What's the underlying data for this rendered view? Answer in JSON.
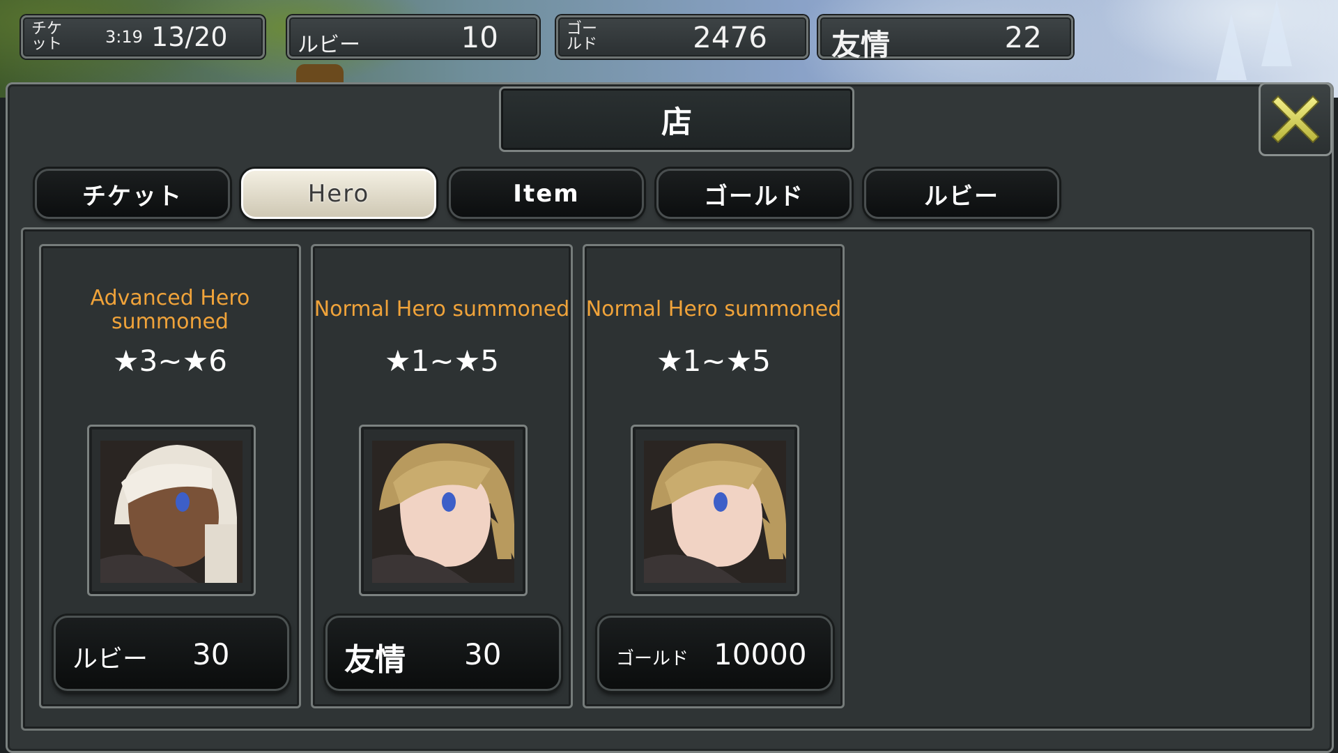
{
  "currency_bar": {
    "ticket": {
      "label": "チケット",
      "timer": "3:19",
      "value": "13/20"
    },
    "ruby": {
      "label": "ルビー",
      "value": "10"
    },
    "gold": {
      "label": "ゴールド",
      "value": "2476"
    },
    "friendship": {
      "label": "友情",
      "value": "22"
    }
  },
  "shop": {
    "title": "店",
    "close_icon": "close-x-icon",
    "tabs": [
      {
        "label": "チケット",
        "active": false
      },
      {
        "label": "Hero",
        "active": true
      },
      {
        "label": "Item",
        "active": false
      },
      {
        "label": "ゴールド",
        "active": false
      },
      {
        "label": "ルビー",
        "active": false
      }
    ],
    "cards": [
      {
        "title": "Advanced Hero summoned",
        "stars": "★3~★6",
        "portrait": "white-hair-hero-portrait",
        "currency": "ルビー",
        "price": "30"
      },
      {
        "title": "Normal Hero summoned",
        "stars": "★1~★5",
        "portrait": "blonde-hair-hero-portrait",
        "currency": "友情",
        "price": "30"
      },
      {
        "title": "Normal Hero summoned",
        "stars": "★1~★5",
        "portrait": "blonde-hair-hero-portrait",
        "currency": "ゴールド",
        "price": "10000"
      }
    ]
  },
  "colors": {
    "card_title": "#f0a33a",
    "close_icon": "#e8e36a",
    "active_tab": "#e8e3d2"
  }
}
